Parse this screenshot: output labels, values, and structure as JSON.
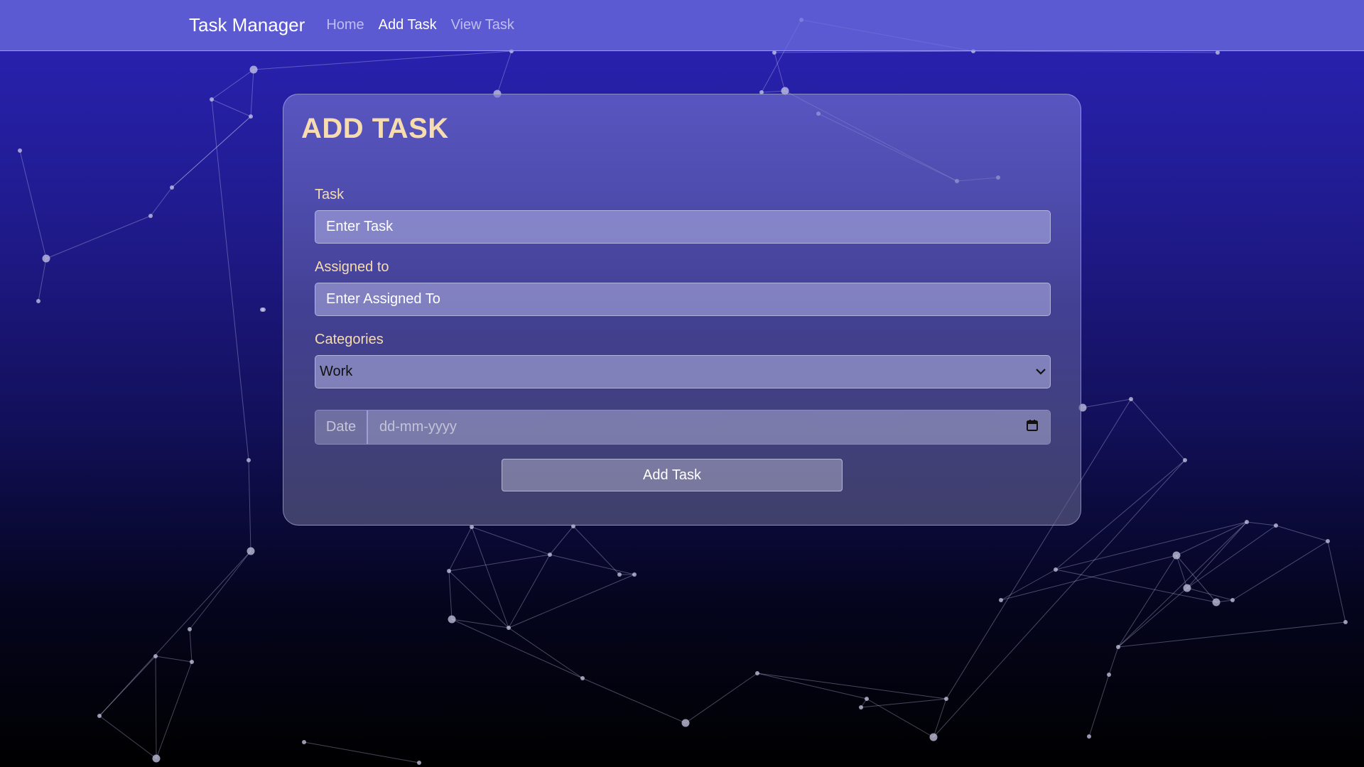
{
  "navbar": {
    "brand": "Task Manager",
    "links": [
      {
        "label": "Home",
        "active": false
      },
      {
        "label": "Add Task",
        "active": true
      },
      {
        "label": "View Task",
        "active": false
      }
    ]
  },
  "form": {
    "title": "ADD TASK",
    "task_label": "Task",
    "task_placeholder": "Enter Task",
    "assigned_label": "Assigned to",
    "assigned_placeholder": "Enter Assigned To",
    "categories_label": "Categories",
    "category_selected": "Work",
    "date_addon": "Date",
    "date_placeholder": "dd-mm-yyyy",
    "submit_label": "Add Task"
  },
  "colors": {
    "accent_label": "#f6dcae",
    "navbar": "#6e6edc",
    "background_top": "#2a23b8",
    "background_bottom": "#000000"
  },
  "icons": {
    "select_arrow": "chevron-down-icon",
    "date_picker": "calendar-icon"
  }
}
